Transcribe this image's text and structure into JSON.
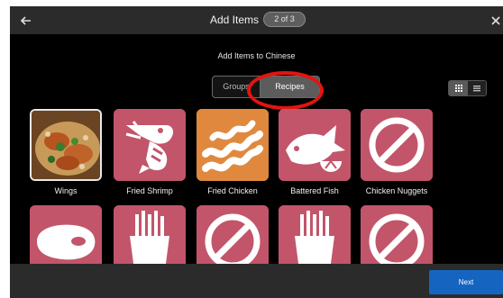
{
  "header": {
    "title": "Add Items",
    "step_badge": "2 of 3",
    "back_icon": "arrow-left-icon",
    "close_icon": "close-icon"
  },
  "subtitle": "Add Items to Chinese",
  "tabs": [
    {
      "label": "Groups",
      "selected": false
    },
    {
      "label": "Recipes",
      "selected": true
    }
  ],
  "view_toggle": {
    "options": [
      "grid",
      "list"
    ],
    "selected": "grid"
  },
  "items_row1": [
    {
      "label": "Wings",
      "icon": "food-photo",
      "color": "#8a5a2a"
    },
    {
      "label": "Fried Shrimp",
      "icon": "shrimp-icon",
      "color": "#c2556a"
    },
    {
      "label": "Fried Chicken",
      "icon": "bacon-strips-icon",
      "color": "#e0893e"
    },
    {
      "label": "Battered Fish",
      "icon": "fish-icon",
      "color": "#c2556a"
    },
    {
      "label": "Chicken Nuggets",
      "icon": "no-symbol-icon",
      "color": "#c2556a"
    }
  ],
  "items_row2": [
    {
      "label": "",
      "icon": "steak-icon",
      "color": "#c2556a"
    },
    {
      "label": "",
      "icon": "fries-icon",
      "color": "#c2556a"
    },
    {
      "label": "",
      "icon": "no-symbol-icon",
      "color": "#c2556a"
    },
    {
      "label": "",
      "icon": "fries-icon",
      "color": "#c2556a"
    },
    {
      "label": "",
      "icon": "no-symbol-icon",
      "color": "#c2556a"
    }
  ],
  "footer": {
    "next_label": "Next"
  },
  "colors": {
    "accent": "#1565c0",
    "tile_pink": "#c2556a",
    "tile_orange": "#e0893e",
    "highlight": "#e3140f"
  }
}
